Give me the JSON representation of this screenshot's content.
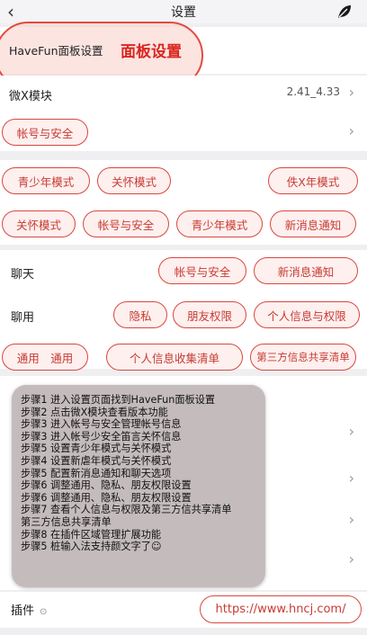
{
  "header": {
    "title": "设置"
  },
  "panel": {
    "label": "HaveFun面板设置",
    "emphasis": "面板设置"
  },
  "wx_module": {
    "label": "微X模块",
    "version": "2.41_4.33"
  },
  "account_row": {
    "label": "帐号与安全"
  },
  "group1_row1": [
    "青少年模式",
    "关怀模式",
    "佚X年模式"
  ],
  "group1_row2": [
    "关怀模式",
    "帐号与安全",
    "青少年模式",
    "新消息通知"
  ],
  "chat": {
    "label": "聊天",
    "buttons": [
      "帐号与安全",
      "新消息通知"
    ]
  },
  "general": {
    "label": "聊用",
    "buttons": [
      "隐私",
      "朋友权限",
      "个人信息与权限"
    ]
  },
  "bottom_buttons": [
    "通用　通用",
    "个人信息收集清单",
    "第三方信息共享清单"
  ],
  "steps": [
    "步骤1 进入设置页面找到HaveFun面板设置",
    "步骤2 点击微X模块查看版本功能",
    "步骤3 进入帐号与安全管理帐号信息",
    "步骤3 进入帐号少安全笛言关怀信息",
    "步骤5 设置青少年模式与关怀模式",
    "步骤4 设置新虐年模式与关怀模式",
    "步骤5 配置新消息通知和聊天选项",
    "步骤6 调整通用、隐私、朋友权限设置",
    "步骤6 调整通用、隐私、朋友权限设置",
    "步骤7 查看个人信息与权限及第三方信共享清单",
    "第三方信息共享清单",
    "步骤8 在插件区域管理扩展功能",
    "步骤5 桩输入法支持颜文字了☺"
  ],
  "plugin": {
    "label": "插件",
    "hint": "⊙",
    "url": "https://www.hncj.com/"
  },
  "colors": {
    "accent": "#d9473f",
    "pill_bg": "#fdf0ef",
    "page_bg": "#efeff1"
  },
  "icons": {
    "back": "chevron-left-icon",
    "leaf": "leaf-icon",
    "chevron": "chevron-right-icon"
  }
}
